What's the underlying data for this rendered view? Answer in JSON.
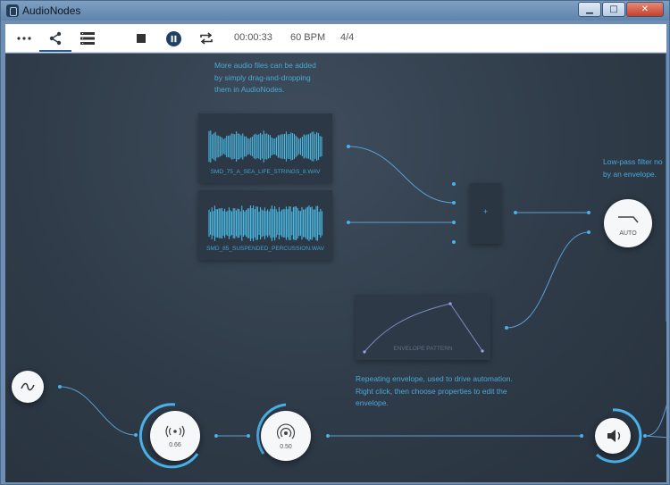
{
  "window": {
    "title": "AudioNodes",
    "minimize": "▁",
    "maximize": "□",
    "close": "✕"
  },
  "toolbar": {
    "more_icon": "more-icon",
    "share_icon": "share-icon",
    "list_icon": "list-icon",
    "stop_icon": "stop-icon",
    "pause_icon": "pause-icon",
    "repeat_icon": "repeat-icon",
    "time": "00:00:33",
    "tempo": "60 BPM",
    "signature": "4/4"
  },
  "canvas": {
    "info_note": [
      "More audio files can be added",
      "by simply drag-and-dropping",
      "them in AudioNodes."
    ],
    "filter_note": [
      "Low-pass filter no",
      "by an envelope."
    ],
    "envelope_note": [
      "Repeating envelope, used to drive automation.",
      "Right click, then choose properties to edit the",
      "envelope."
    ],
    "audio_files": [
      {
        "name": "SMD_75_A_SEA_LIFE_STRINGS_8.WAV"
      },
      {
        "name": "SMD_85_SUSPENDED_PERCUSSION.WAV"
      }
    ],
    "mixer_symbol": "+",
    "envelope_label": "ENVELOPE PATTERN",
    "filter_node": {
      "label": "AUTO"
    },
    "lfo_node": {
      "icon": "wave-icon"
    },
    "panner_node": {
      "value": "0.66",
      "icon": "panner-icon"
    },
    "reverb_node": {
      "value": "0.50",
      "icon": "reverb-icon"
    },
    "output_node": {
      "icon": "speaker-icon"
    }
  },
  "colors": {
    "accent": "#4ab0e8",
    "wire": "#5b9fd0",
    "background": "#2f3b48",
    "node_fill": "#f6f7f8"
  }
}
